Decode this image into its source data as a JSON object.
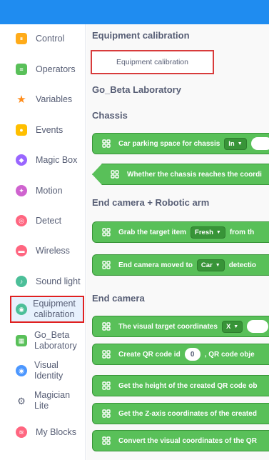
{
  "sidebar": {
    "items": [
      {
        "label": "Control",
        "icon": "control-icon",
        "color": "#ffab19"
      },
      {
        "label": "Operators",
        "icon": "operators-icon",
        "color": "#59c059"
      },
      {
        "label": "Variables",
        "icon": "variables-icon",
        "color": "#ff8c1a"
      },
      {
        "label": "Events",
        "icon": "events-icon",
        "color": "#ffbf00"
      },
      {
        "label": "Magic Box",
        "icon": "magic-box-icon",
        "color": "#9966ff"
      },
      {
        "label": "Motion",
        "icon": "motion-icon",
        "color": "#cf63cf"
      },
      {
        "label": "Detect",
        "icon": "detect-icon",
        "color": "#ff6680"
      },
      {
        "label": "Wireless",
        "icon": "wireless-icon",
        "color": "#ff6680"
      },
      {
        "label": "Sound light",
        "icon": "sound-light-icon",
        "color": "#4cbf99"
      },
      {
        "label": "Equipment calibration",
        "icon": "equipment-calibration-icon",
        "color": "#4cbf99"
      },
      {
        "label": "Go_Beta Laboratory",
        "icon": "go-beta-laboratory-icon",
        "color": "#59c059"
      },
      {
        "label": "Visual Identity",
        "icon": "visual-identity-icon",
        "color": "#4c97ff"
      },
      {
        "label": "Magician Lite",
        "icon": "magician-lite-icon",
        "color": "#575e75"
      },
      {
        "label": "My Blocks",
        "icon": "my-blocks-icon",
        "color": "#ff6680"
      }
    ]
  },
  "workspace": {
    "header_equipment": "Equipment calibration",
    "equipment_button": "Equipment calibration",
    "header_gobeta": "Go_Beta Laboratory",
    "header_chassis": "Chassis",
    "header_endcam_arm": "End camera + Robotic arm",
    "header_endcam": "End camera",
    "blocks": {
      "parking": {
        "text": "Car parking space for chassis",
        "dropdown": "In"
      },
      "reaches": {
        "text": "Whether the chassis reaches the coordi"
      },
      "grab": {
        "text": "Grab the target item",
        "dropdown": "Fresh",
        "tail": "from th"
      },
      "camera_moved": {
        "text": "End camera moved to",
        "dropdown": "Car",
        "tail": "detectio"
      },
      "visual_target": {
        "text": "The visual target coordinates",
        "dropdown": "X"
      },
      "create_qr": {
        "text": "Create QR code id",
        "value": "0",
        "tail": ", QR code obje"
      },
      "height_qr": {
        "text": "Get the height of the created QR code ob"
      },
      "zaxis": {
        "text": "Get the Z-axis coordinates of the created"
      },
      "convert": {
        "text": "Convert the visual coordinates of the QR"
      }
    }
  },
  "colors": {
    "topbar": "#1f8cf0",
    "block_green": "#59c059",
    "highlight_red": "#e02020"
  }
}
